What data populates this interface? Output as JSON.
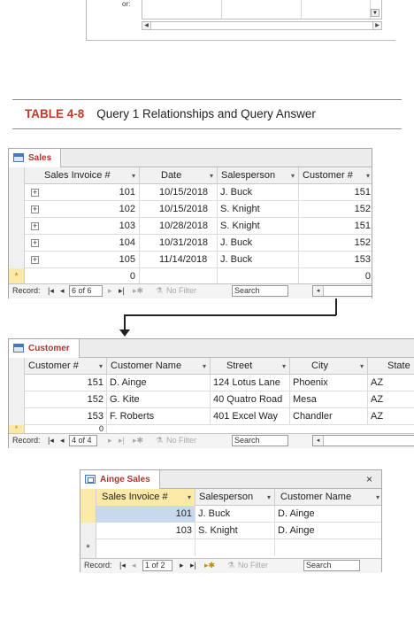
{
  "top_fragment": {
    "label": "or:"
  },
  "caption": {
    "number": "TABLE 4-8",
    "title": "Query 1 Relationships and Query Answer"
  },
  "sales": {
    "tab": "Sales",
    "columns": [
      "Sales Invoice #",
      "Date",
      "Salesperson",
      "Customer #"
    ],
    "rows": [
      [
        "101",
        "10/15/2018",
        "J. Buck",
        "151"
      ],
      [
        "102",
        "10/15/2018",
        "S. Knight",
        "152"
      ],
      [
        "103",
        "10/28/2018",
        "S. Knight",
        "151"
      ],
      [
        "104",
        "10/31/2018",
        "J. Buck",
        "152"
      ],
      [
        "105",
        "11/14/2018",
        "J. Buck",
        "153"
      ]
    ],
    "new_row": {
      "marker": "*",
      "invoice": "0",
      "customer": "0"
    },
    "nav": {
      "label": "Record:",
      "position": "6 of 6",
      "filter": "No Filter",
      "search": "Search"
    }
  },
  "customer": {
    "tab": "Customer",
    "columns": [
      "Customer #",
      "Customer Name",
      "Street",
      "City",
      "State"
    ],
    "rows": [
      [
        "151",
        "D. Ainge",
        "124 Lotus Lane",
        "Phoenix",
        "AZ"
      ],
      [
        "152",
        "G. Kite",
        "40 Quatro Road",
        "Mesa",
        "AZ"
      ],
      [
        "153",
        "F. Roberts",
        "401 Excel Way",
        "Chandler",
        "AZ"
      ]
    ],
    "new_row": {
      "marker": "*",
      "customer": "0"
    },
    "nav": {
      "label": "Record:",
      "position": "4 of 4",
      "filter": "No Filter",
      "search": "Search"
    }
  },
  "aingesales": {
    "tab": "Ainge Sales",
    "close": "×",
    "columns": [
      "Sales Invoice #",
      "Salesperson",
      "Customer Name"
    ],
    "rows": [
      [
        "101",
        "J. Buck",
        "D. Ainge"
      ],
      [
        "103",
        "S. Knight",
        "D. Ainge"
      ]
    ],
    "new_row": {
      "marker": "*"
    },
    "nav": {
      "label": "Record:",
      "position": "1 of 2",
      "filter": "No Filter",
      "search": "Search"
    }
  }
}
